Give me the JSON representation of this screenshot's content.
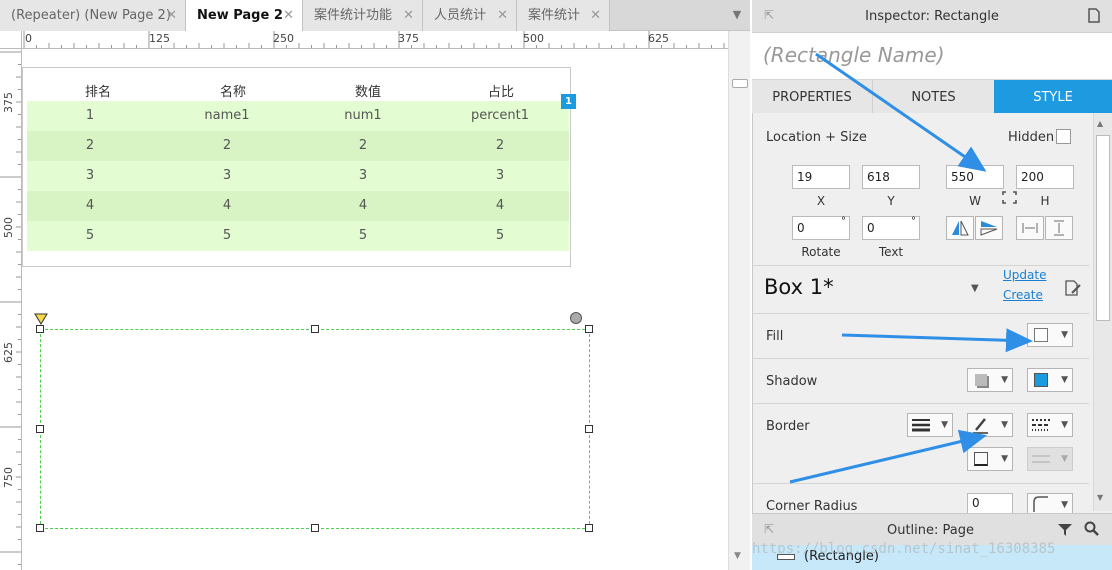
{
  "tabs": [
    {
      "label": "(Repeater) (New Page 2)",
      "active": false
    },
    {
      "label": "New Page 2",
      "active": true
    },
    {
      "label": "案件统计功能",
      "active": false
    },
    {
      "label": "人员统计",
      "active": false
    },
    {
      "label": "案件统计",
      "active": false
    }
  ],
  "tab_close": "✕",
  "ruler": {
    "h_labels": [
      "0",
      "125",
      "250",
      "375",
      "500",
      "625"
    ],
    "v_labels": [
      "375",
      "500",
      "625",
      "750"
    ]
  },
  "repeater": {
    "headers": [
      "排名",
      "名称",
      "数值",
      "占比"
    ],
    "rows": [
      [
        "1",
        "name1",
        "num1",
        "percent1"
      ],
      [
        "2",
        "2",
        "2",
        "2"
      ],
      [
        "3",
        "3",
        "3",
        "3"
      ],
      [
        "4",
        "4",
        "4",
        "4"
      ],
      [
        "5",
        "5",
        "5",
        "5"
      ]
    ],
    "badge": "1",
    "row_colors": [
      "#e3fcd2",
      "#d8f4c4"
    ]
  },
  "inspector": {
    "title": "Inspector: Rectangle",
    "name_placeholder": "(Rectangle Name)",
    "tabs": [
      "PROPERTIES",
      "NOTES",
      "STYLE"
    ],
    "active_tab": "STYLE",
    "location_size_label": "Location + Size",
    "hidden_label": "Hidden",
    "x": "19",
    "x_label": "X",
    "y": "618",
    "y_label": "Y",
    "w": "550",
    "w_label": "W",
    "h": "200",
    "h_label": "H",
    "rotate": "0",
    "rotate_label": "Rotate",
    "text_rot": "0",
    "text_label": "Text",
    "style_name": "Box 1*",
    "update_link": "Update",
    "create_link": "Create",
    "fill_label": "Fill",
    "shadow_label": "Shadow",
    "border_label": "Border",
    "corner_radius_label": "Corner Radius",
    "corner_radius": "0"
  },
  "outline": {
    "title": "Outline: Page",
    "item": "(Rectangle)"
  },
  "watermark": "https://blog.csdn.net/sinat_16308385",
  "colors": {
    "accent": "#1e9ae0",
    "selection": "#4ecf4e",
    "annotation_arrow": "#2f8fe6"
  }
}
